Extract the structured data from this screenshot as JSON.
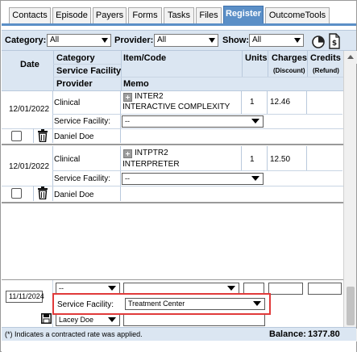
{
  "tabs": [
    "Contacts",
    "Episode",
    "Payers",
    "Forms",
    "Tasks",
    "Files",
    "Register",
    "OutcomeTools"
  ],
  "active_tab": "Register",
  "filters": {
    "category_label": "Category:",
    "category_value": "All",
    "provider_label": "Provider:",
    "provider_value": "All",
    "show_label": "Show:",
    "show_value": "All"
  },
  "header": {
    "date": "Date",
    "category": "Category",
    "service_facility": "Service Facility",
    "provider": "Provider",
    "item_code": "Item/Code",
    "memo": "Memo",
    "units": "Units",
    "charges": "Charges",
    "discount": "(Discount)",
    "credits": "Credits",
    "refund": "(Refund)"
  },
  "entries": [
    {
      "date": "12/01/2022",
      "category": "Clinical",
      "code": "INTER2",
      "description": "INTERACTIVE COMPLEXITY",
      "units": "1",
      "charges": "12.46",
      "facility_label": "Service Facility:",
      "facility_value": "--",
      "provider": "Daniel Doe"
    },
    {
      "date": "12/01/2022",
      "category": "Clinical",
      "code": "INTPTR2",
      "description": "INTERPRETER",
      "units": "1",
      "charges": "12.50",
      "facility_label": "Service Facility:",
      "facility_value": "--",
      "provider": "Daniel Doe"
    }
  ],
  "new_entry": {
    "date": "11/11/2024",
    "category_value": "--",
    "facility_label": "Service Facility:",
    "facility_value": "Treatment Center",
    "provider_value": "Lacey Doe"
  },
  "footer": {
    "note": "(*) Indicates a contracted rate was applied.",
    "balance_label": "Balance:",
    "balance_value": "1377.80"
  },
  "colors": {
    "accent": "#5b8fc7",
    "header_bg": "#dbe6f2",
    "highlight": "#e03a3a"
  }
}
